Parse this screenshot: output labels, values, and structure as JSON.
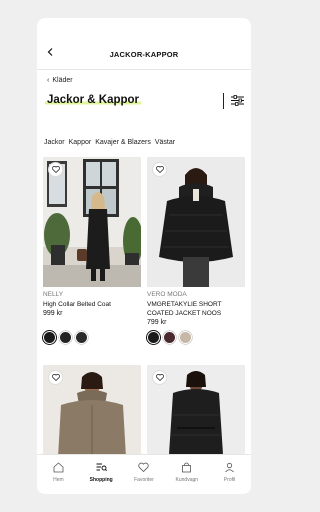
{
  "header": {
    "title": "JACKOR-KAPPOR"
  },
  "breadcrumb": {
    "label": "Kläder"
  },
  "page": {
    "title": "Jackor & Kappor"
  },
  "chips": [
    "Jackor",
    "Kappor",
    "Kavajer & Blazers",
    "Västar"
  ],
  "products": [
    {
      "brand": "NELLY",
      "name": "High Collar Belted Coat",
      "price": "999 kr",
      "swatches": [
        "#1a1a1a",
        "#222222",
        "#2a2a2a"
      ],
      "selected": 0
    },
    {
      "brand": "VERO MODA",
      "name": "VMGRETAKYLIE SHORT COATED JACKET NOOS",
      "price": "799 kr",
      "swatches": [
        "#1a1a1a",
        "#4a2a2e",
        "#c7b7a6"
      ],
      "selected": 0
    },
    {
      "brand": "",
      "name": "",
      "price": "",
      "swatches": []
    },
    {
      "brand": "",
      "name": "",
      "price": "",
      "swatches": []
    }
  ],
  "tabbar": {
    "items": [
      {
        "label": "Hem",
        "icon": "home-icon"
      },
      {
        "label": "Shopping",
        "icon": "shopping-list-icon",
        "active": true
      },
      {
        "label": "Favoriter",
        "icon": "heart-icon"
      },
      {
        "label": "Kundvagn",
        "icon": "bag-icon"
      },
      {
        "label": "Profil",
        "icon": "person-icon"
      }
    ]
  },
  "colors": {
    "accent_highlight": "#dff59a",
    "text": "#111111",
    "muted": "#777777"
  }
}
